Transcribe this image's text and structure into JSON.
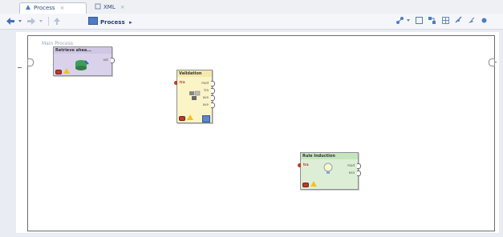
{
  "tabs": [
    {
      "label": "Process",
      "active": true
    },
    {
      "label": "XML",
      "active": false
    }
  ],
  "toolbar": {
    "breadcrumb": "Process",
    "breadcrumb_arrow": "▸"
  },
  "canvas": {
    "title": "Main Process"
  },
  "operators": {
    "retrieve": {
      "title": "Retrieve ahea...",
      "out_label": "out",
      "bg": "#d9d2ea"
    },
    "validation": {
      "title": "Validation",
      "in_label": "tra",
      "out_labels": [
        "mod",
        "tra",
        "ave",
        "ave"
      ],
      "bg": "#fbf4c7"
    },
    "rule_induction": {
      "title": "Rule Induction",
      "in_label": "tra",
      "out_labels": [
        "mod",
        "exa"
      ],
      "bg": "#dcefd6"
    }
  },
  "colors": {
    "accent": "#2e4a7a",
    "error": "#c0392b",
    "warning": "#f0c419"
  }
}
